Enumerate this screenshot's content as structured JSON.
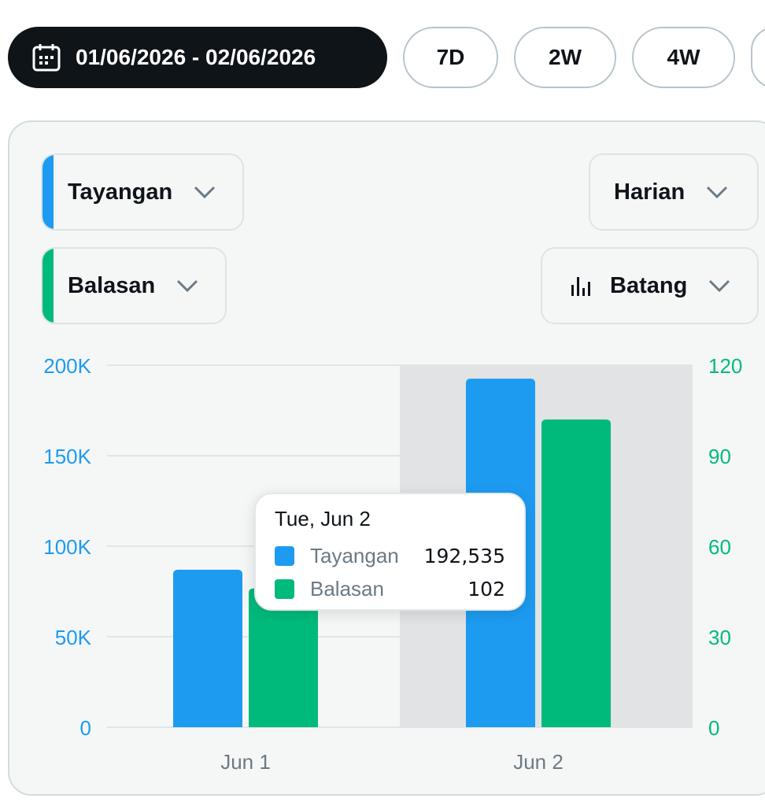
{
  "range": {
    "date_label": "01/06/2026 - 02/06/2026",
    "presets": [
      "7D",
      "2W",
      "4W"
    ],
    "calendar_icon": "calendar-icon"
  },
  "controls": {
    "metric_primary": {
      "label": "Tayangan",
      "color": "#1d9bf0",
      "icon": "chevron-down-icon"
    },
    "metric_secondary": {
      "label": "Balasan",
      "color": "#00ba7c",
      "icon": "chevron-down-icon"
    },
    "interval": {
      "label": "Harian",
      "icon": "chevron-down-icon"
    },
    "chart_type": {
      "label": "Batang",
      "icon": "bar-chart-icon"
    }
  },
  "tooltip": {
    "title": "Tue, Jun 2",
    "rows": [
      {
        "name": "Tayangan",
        "value": "192,535",
        "color": "#1d9bf0"
      },
      {
        "name": "Balasan",
        "value": "102",
        "color": "#00ba7c"
      }
    ]
  },
  "chart_data": {
    "type": "bar",
    "categories": [
      "Jun 1",
      "Jun 2"
    ],
    "highlighted_category": "Jun 2",
    "series": [
      {
        "name": "Tayangan",
        "values": [
          87000,
          192535
        ],
        "axis": "left",
        "color": "#1d9bf0"
      },
      {
        "name": "Balasan",
        "values": [
          46,
          102
        ],
        "axis": "right",
        "color": "#00ba7c"
      }
    ],
    "y_left": {
      "ticks": [
        0,
        50000,
        100000,
        150000,
        200000
      ],
      "tick_labels": [
        "0",
        "50K",
        "100K",
        "150K",
        "200K"
      ],
      "range": [
        0,
        200000
      ],
      "color": "#1d9bf0"
    },
    "y_right": {
      "ticks": [
        0,
        30,
        60,
        90,
        120
      ],
      "tick_labels": [
        "0",
        "30",
        "60",
        "90",
        "120"
      ],
      "range": [
        0,
        120
      ],
      "color": "#00ba7c"
    },
    "grid": true
  }
}
